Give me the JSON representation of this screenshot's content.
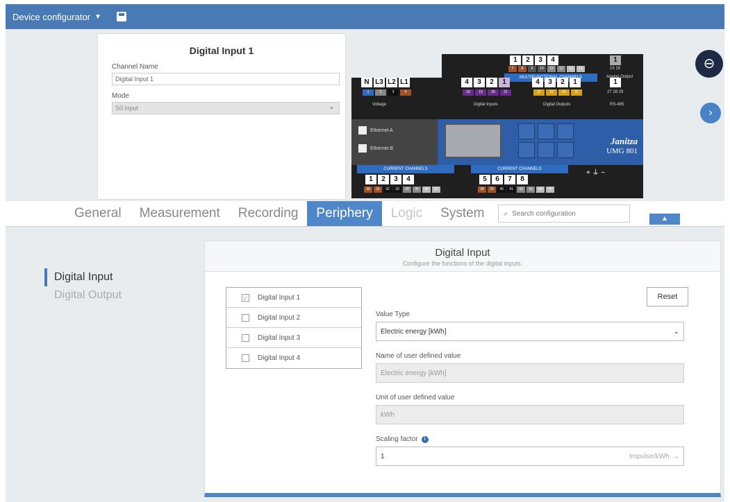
{
  "topbar": {
    "title": "Device configurator",
    "caret": "▼"
  },
  "channel_card": {
    "title": "Digital Input 1",
    "channel_name_label": "Channel Name",
    "channel_name_value": "Digital Input 1",
    "mode_label": "Mode",
    "mode_value": "S0 input"
  },
  "device": {
    "brand": "Janitza",
    "model": "UMG 801",
    "voltage_terminals": [
      "N",
      "L3",
      "L2",
      "L1"
    ],
    "voltage_pins": [
      "1",
      "2",
      "3",
      "4"
    ],
    "voltage_label": "Voltage",
    "digital_in_terminals": [
      "4",
      "3",
      "2",
      "1"
    ],
    "digital_in_pins": [
      "18",
      "19",
      "20",
      "21"
    ],
    "digital_in_label": "Digital Inputs",
    "digital_out_terminals": [
      "4",
      "3",
      "2",
      "1"
    ],
    "digital_out_pins": [
      "22",
      "23",
      "24",
      "25"
    ],
    "digital_out_label": "Digital Outputs",
    "rs485_terminal": "1",
    "rs485_pins": "27 28 29",
    "rs485_label": "RS-485",
    "multi_terminals": [
      "1",
      "2",
      "3",
      "4"
    ],
    "multi_pins": [
      "7",
      "8",
      "9",
      "10",
      "11",
      "12",
      "13",
      "14"
    ],
    "multi_label": "MULTIFUNCTIONAL CHANNELS",
    "analog_terminal": "1",
    "analog_pins": "15 16",
    "analog_label": "Analog Output",
    "ethernet_a": "Ethernet A",
    "ethernet_b": "Ethernet B",
    "current_label_1": "CURRENT CHANNELS",
    "current_label_2": "CURRENT CHANNELS",
    "current_terminals_1": [
      "1",
      "2",
      "3",
      "4"
    ],
    "current_pins_1": [
      "30",
      "31",
      "32",
      "33",
      "34",
      "35",
      "36",
      "37"
    ],
    "current_terminals_2": [
      "5",
      "6",
      "7",
      "8"
    ],
    "current_pins_2": [
      "38",
      "39",
      "40",
      "41",
      "42",
      "43",
      "44",
      "45"
    ],
    "power_symbols": "+ ⏚ −"
  },
  "tabs": [
    {
      "label": "General"
    },
    {
      "label": "Measurement"
    },
    {
      "label": "Recording"
    },
    {
      "label": "Periphery"
    },
    {
      "label": "Logic"
    },
    {
      "label": "System"
    }
  ],
  "search": {
    "placeholder": "Search configuration"
  },
  "sidenav": {
    "digital_input": "Digital Input",
    "digital_output": "Digital Output"
  },
  "panel": {
    "title": "Digital Input",
    "subtitle": "Configure the functions of the digital inputs.",
    "inputs": [
      {
        "label": "Digital Input 1",
        "checked": true
      },
      {
        "label": "Digital Input 2",
        "checked": false
      },
      {
        "label": "Digital Input 3",
        "checked": false
      },
      {
        "label": "Digital Input 4",
        "checked": false
      }
    ],
    "reset_label": "Reset",
    "value_type_label": "Value Type",
    "value_type_value": "Electric energy [kWh]",
    "name_label": "Name of user defined value",
    "name_value": "Electric energy [kWh]",
    "unit_label": "Unit of user defined value",
    "unit_value": "kWh",
    "scaling_label": "Scaling factor",
    "scaling_value": "1",
    "scaling_unit": "Impulse/kWh"
  },
  "colors": {
    "topbar": "#4a7ab5",
    "accent": "#4f87c8",
    "device_body": "#2f5ea8"
  }
}
